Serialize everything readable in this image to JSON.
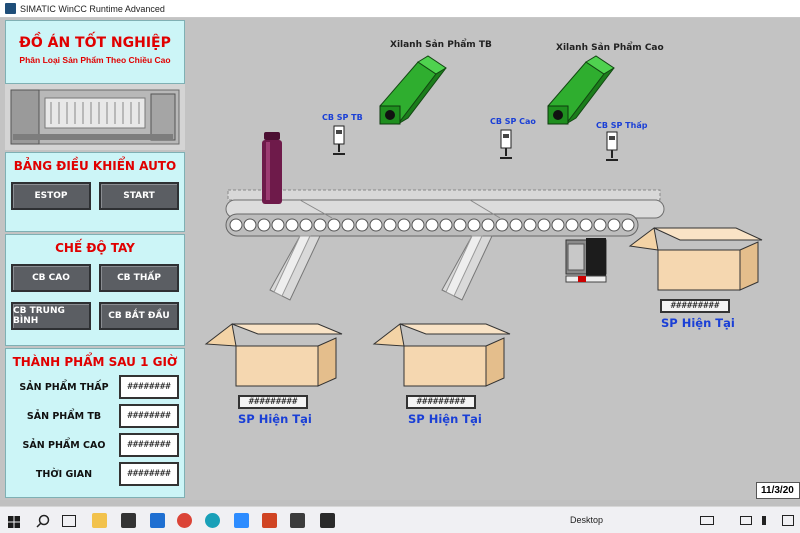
{
  "window": {
    "title": "SIMATIC WinCC Runtime Advanced"
  },
  "header": {
    "title": "ĐỒ ÁN TỐT NGHIỆP",
    "subtitle": "Phân Loại Sản Phẩm Theo Chiều Cao"
  },
  "auto_panel": {
    "title": "BẢNG ĐIỀU KHIỂN AUTO",
    "estop": "ESTOP",
    "start": "START"
  },
  "manual_panel": {
    "title": "CHẾ ĐỘ TAY",
    "cb_cao": "CB CAO",
    "cb_thap": "CB THẤP",
    "cb_trung_binh": "CB TRUNG BÌNH",
    "cb_bat_dau": "CB BẮT ĐẦU"
  },
  "output_panel": {
    "title": "THÀNH PHẨM SAU 1 GIỜ",
    "rows": [
      {
        "label": "SẢN PHẨM THẤP",
        "value": "########"
      },
      {
        "label": "SẢN PHẨM TB",
        "value": "########"
      },
      {
        "label": "SẢN PHẨM CAO",
        "value": "########"
      },
      {
        "label": "THỜI GIAN",
        "value": "########"
      }
    ]
  },
  "process": {
    "cylinder_tb_label": "Xilanh Sản Phẩm TB",
    "cylinder_cao_label": "Xilanh Sản Phẩm Cao",
    "sensor_tb_label": "CB SP TB",
    "sensor_cao_label": "CB SP Cao",
    "sensor_thap_label": "CB SP Thấp",
    "box_label": "SP Hiện Tại",
    "box_value": "#########"
  },
  "status": {
    "date": "11/3/20"
  },
  "taskbar": {
    "search_label": "Desktop"
  },
  "colors": {
    "panel_bg": "#ccf5f7",
    "title_red": "#e00000",
    "label_blue": "#1a3fd6",
    "cylinder_green": "#2fae2f",
    "box": "#f5d7b0",
    "bottle": "#6e1a4a"
  }
}
